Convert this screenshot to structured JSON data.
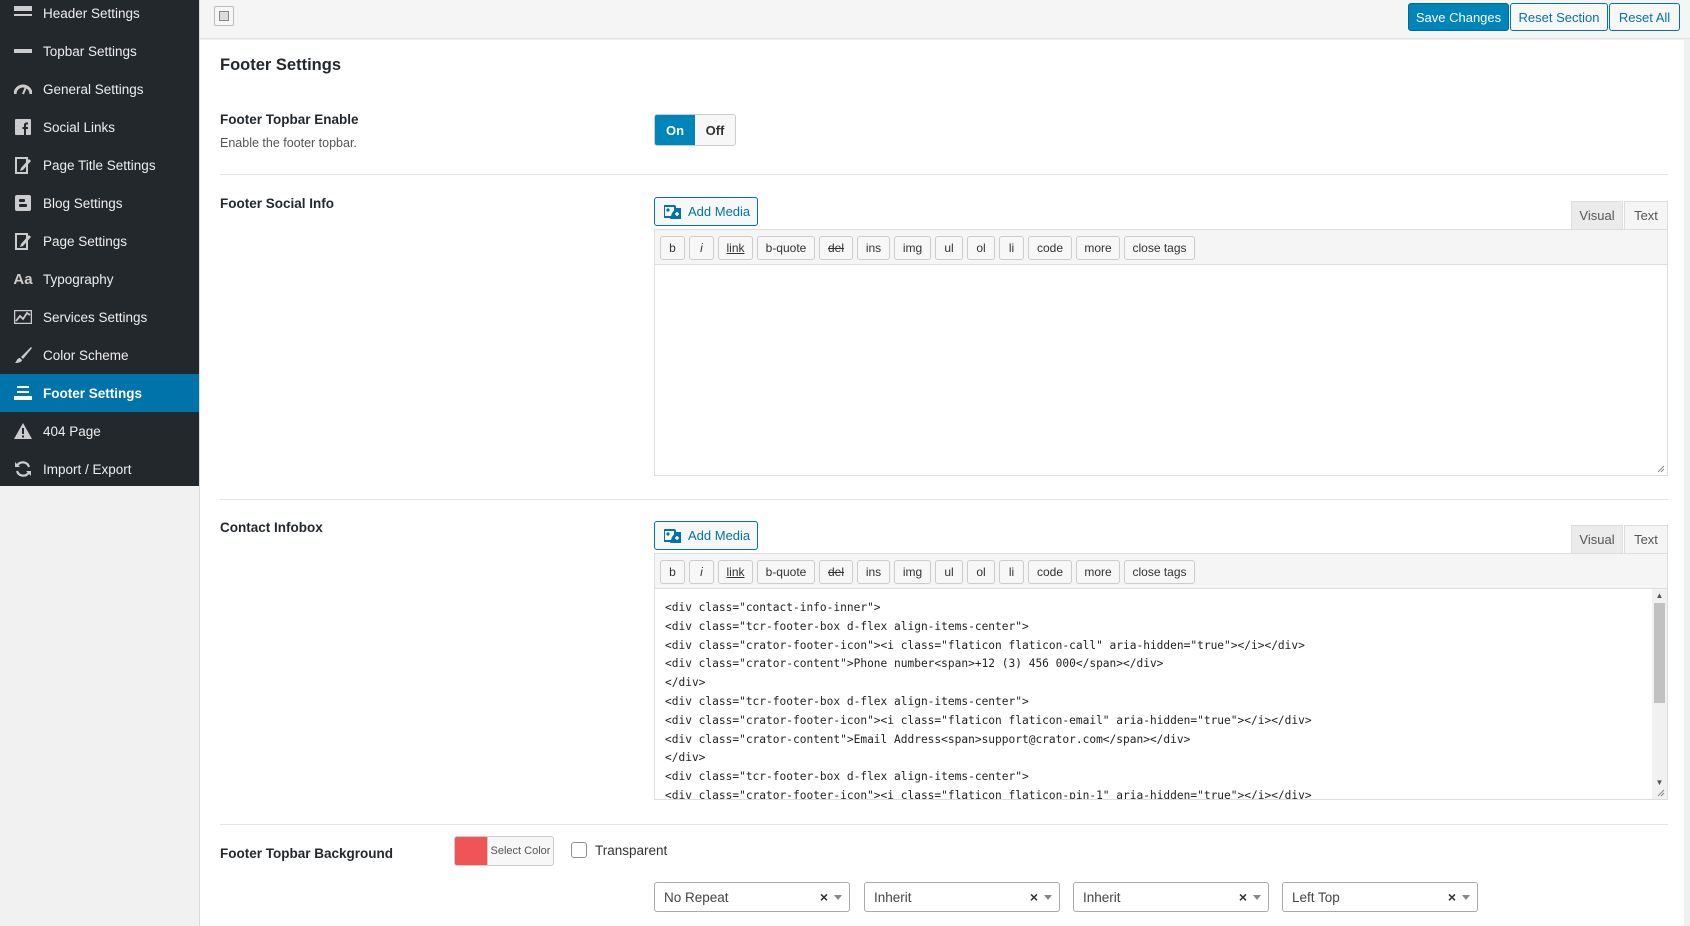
{
  "sidebar": {
    "items": [
      {
        "label": "Header Settings",
        "icon": "header-icon"
      },
      {
        "label": "Topbar Settings",
        "icon": "minus-bar-icon"
      },
      {
        "label": "General Settings",
        "icon": "dashboard-gauge-icon"
      },
      {
        "label": "Social Links",
        "icon": "facebook-icon"
      },
      {
        "label": "Page Title Settings",
        "icon": "edit-page-icon"
      },
      {
        "label": "Blog Settings",
        "icon": "blogger-icon"
      },
      {
        "label": "Page Settings",
        "icon": "edit-page-icon"
      },
      {
        "label": "Typography",
        "icon": "typography-icon"
      },
      {
        "label": "Services Settings",
        "icon": "chart-line-icon"
      },
      {
        "label": "Color Scheme",
        "icon": "brush-icon"
      },
      {
        "label": "Footer Settings",
        "icon": "footer-icon",
        "active": true
      },
      {
        "label": "404 Page",
        "icon": "warning-icon"
      },
      {
        "label": "Import / Export",
        "icon": "refresh-icon"
      }
    ]
  },
  "toolbar": {
    "save_label": "Save Changes",
    "reset_section_label": "Reset Section",
    "reset_all_label": "Reset All"
  },
  "page": {
    "title": "Footer Settings"
  },
  "fields": {
    "footer_topbar_enable": {
      "label": "Footer Topbar Enable",
      "desc": "Enable the footer topbar.",
      "on_label": "On",
      "off_label": "Off",
      "value": "On"
    },
    "footer_social_info": {
      "label": "Footer Social Info",
      "content": ""
    },
    "contact_infobox": {
      "label": "Contact Infobox",
      "content": "<div class=\"contact-info-inner\">\n<div class=\"tcr-footer-box d-flex align-items-center\">\n<div class=\"crator-footer-icon\"><i class=\"flaticon flaticon-call\" aria-hidden=\"true\"></i></div>\n<div class=\"crator-content\">Phone number<span>+12 (3) 456 000</span></div>\n</div>\n<div class=\"tcr-footer-box d-flex align-items-center\">\n<div class=\"crator-footer-icon\"><i class=\"flaticon flaticon-email\" aria-hidden=\"true\"></i></div>\n<div class=\"crator-content\">Email Address<span>support@crator.com</span></div>\n</div>\n<div class=\"tcr-footer-box d-flex align-items-center\">\n<div class=\"crator-footer-icon\"><i class=\"flaticon flaticon-pin-1\" aria-hidden=\"true\"></i></div>"
    },
    "footer_topbar_background": {
      "label": "Footer Topbar Background",
      "color": "#f05454",
      "select_color_label": "Select Color",
      "transparent_label": "Transparent",
      "selects": [
        "No Repeat",
        "Inherit",
        "Inherit",
        "Left Top"
      ]
    }
  },
  "editor": {
    "add_media_label": "Add Media",
    "visual_label": "Visual",
    "text_label": "Text",
    "quicktags": [
      "b",
      "i",
      "link",
      "b-quote",
      "del",
      "ins",
      "img",
      "ul",
      "ol",
      "li",
      "code",
      "more",
      "close tags"
    ]
  },
  "colors": {
    "sidebar_bg": "#23282d",
    "accent": "#0073aa",
    "primary_button": "#0085ba"
  }
}
